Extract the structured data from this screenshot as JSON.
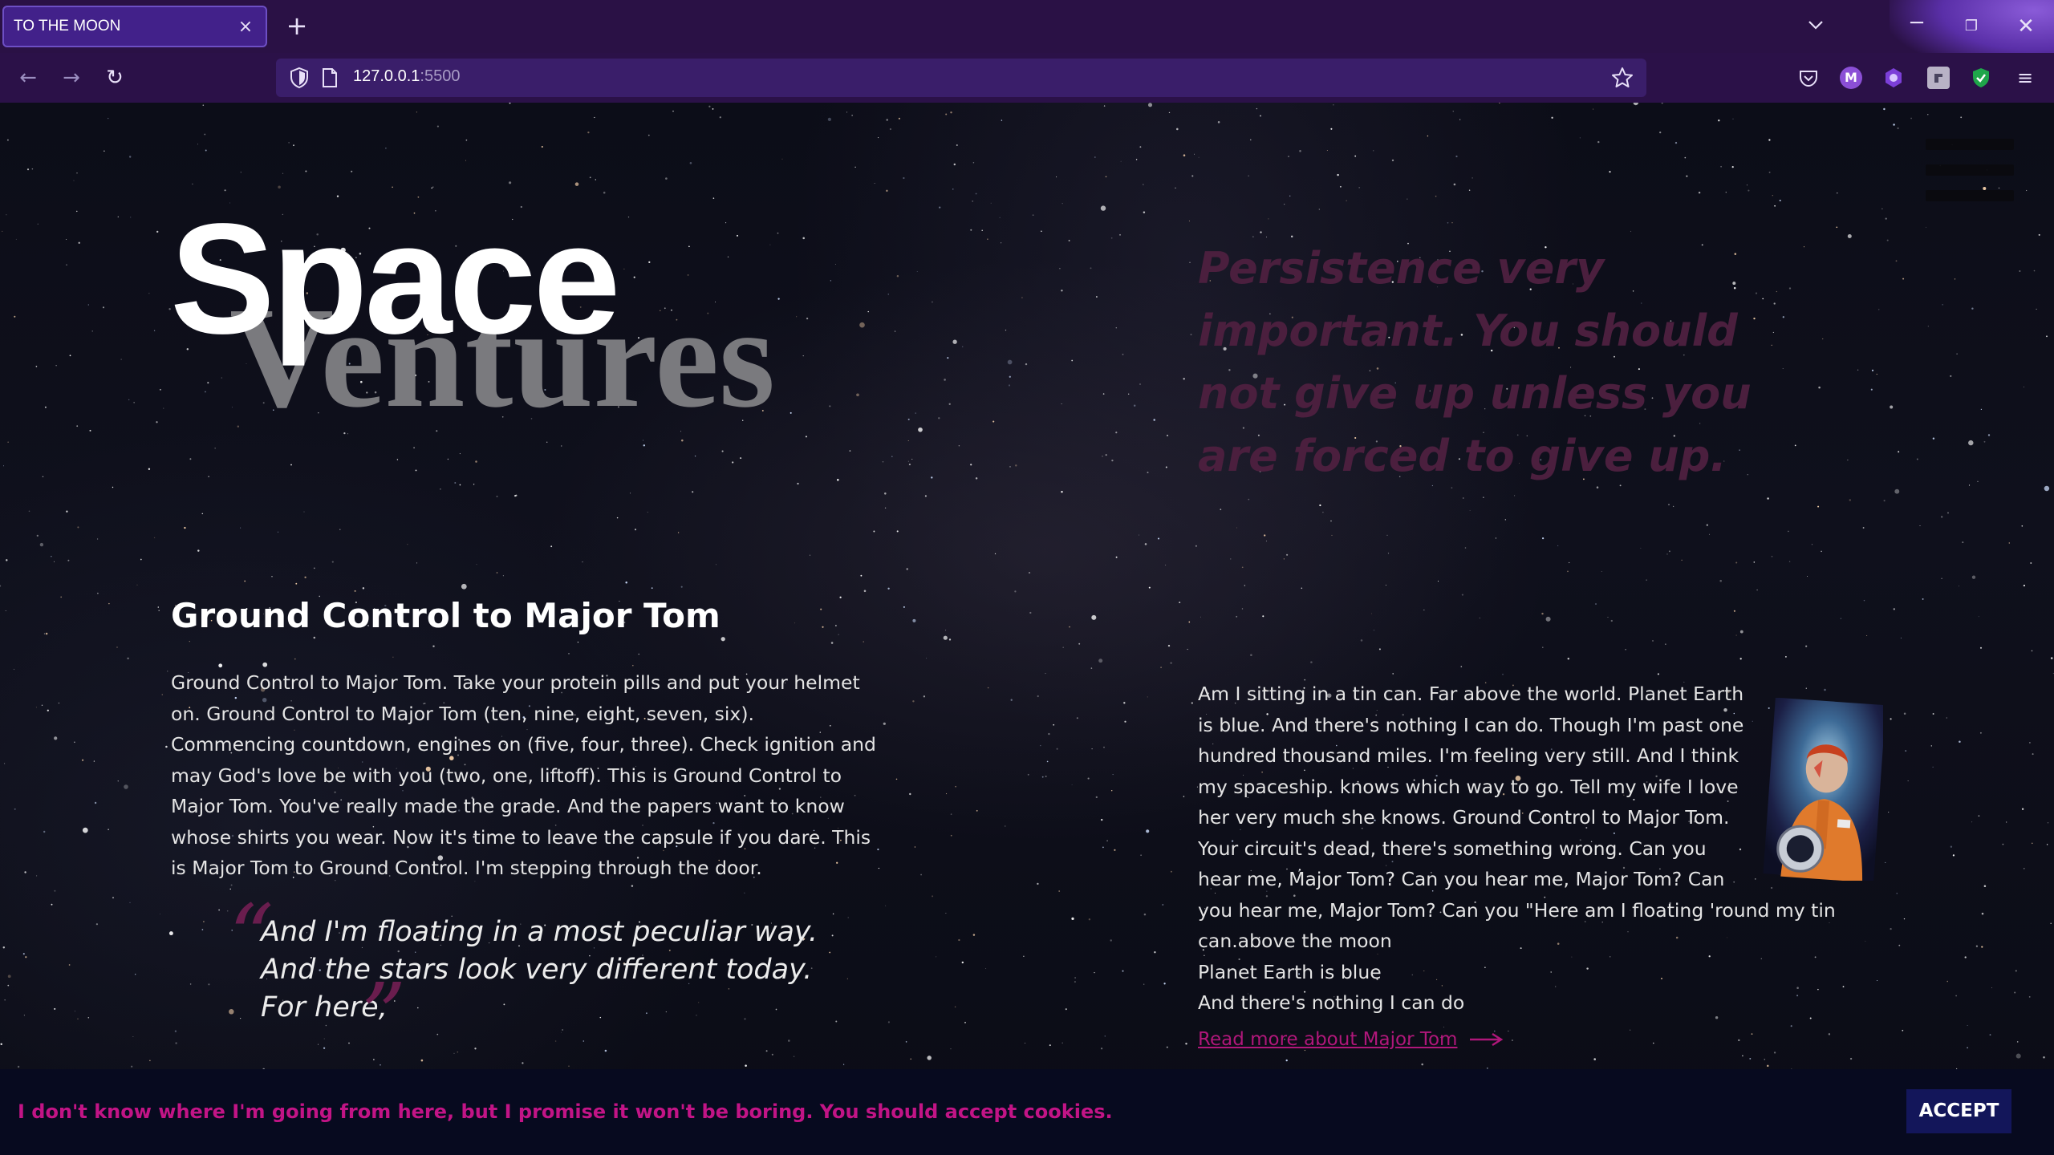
{
  "browser": {
    "tab_title": "TO THE MOON",
    "tab_close": "×",
    "new_tab": "+",
    "url_host": "127.0.0.1",
    "url_port": ":5500",
    "icons": [
      "back-icon",
      "forward-icon",
      "reload-icon",
      "shield-icon",
      "page-icon",
      "star-icon",
      "pocket-icon",
      "m-extension-icon",
      "puzzle-extension-icon",
      "grey-extension-icon",
      "shield-extension-icon",
      "menu-icon"
    ],
    "extension_m": "M",
    "menu_glyph": "≡",
    "win_min": "─",
    "win_max": "❐",
    "win_close": "✕",
    "nav_back": "←",
    "nav_forward": "→",
    "nav_reload": "↻"
  },
  "page": {
    "title_line1": "Space",
    "title_line2": "Ventures",
    "left_heading": "Ground Control to Major Tom",
    "left_paragraph": "Ground Control to Major Tom. Take your protein pills and put your helmet on. Ground Control to Major Tom (ten, nine, eight, seven, six). Commencing countdown, engines on (five, four, three). Check ignition and may God's love be with you (two, one, liftoff). This is Ground Control to Major Tom. You've really made the grade. And the papers want to know whose shirts you wear. Now it's time to leave the capsule if you dare. This is Major Tom to Ground Control. I'm stepping through the door.",
    "quote_open": "“",
    "quote_close": "”",
    "quote_line1": "And I'm floating in a most peculiar way.",
    "quote_line2": "And the stars look very different today.",
    "quote_line3": "For here,",
    "persistence_quote": "Persistence very important. You should not give up unless you are forced to give up.",
    "right_paragraph": "Am I sitting in a tin can. Far above the world. Planet Earth is blue. And there's nothing I can do. Though I'm past one hundred thousand miles. I'm feeling very still. And I think my spaceship. knows which way to go. Tell my wife I love her very much she knows. Ground Control to Major Tom. Your circuit's dead, there's something wrong. Can you hear me, Major Tom? Can you hear me, Major Tom? Can you hear me, Major Tom? Can you \"Here am I floating 'round my tin can.above the moon",
    "right_line2": "Planet Earth is blue",
    "right_line3": "And there's nothing I can do",
    "read_more": "Read more about Major Tom"
  },
  "cookie": {
    "text": "I don't know where I'm going from here, but I promise it won't be boring. You should accept cookies.",
    "accept": "ACCEPT"
  },
  "colors": {
    "chrome_bg": "#2a1145",
    "tab_active": "#42218a",
    "url_bg": "#3a1e6a",
    "accent_magenta": "#c21486",
    "persistence_text": "#4b1f3e",
    "accept_bg": "#13165a"
  }
}
